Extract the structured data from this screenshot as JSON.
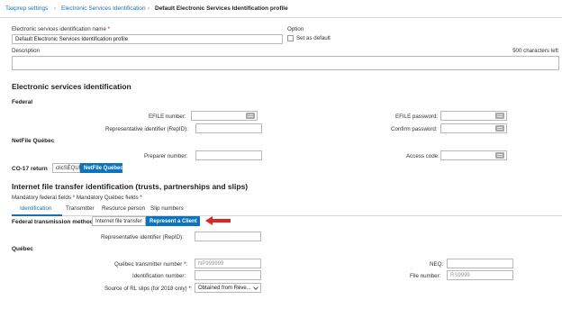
{
  "breadcrumb": {
    "items": [
      "Taxprep settings",
      "Electronic Services Identification",
      "Default Electronic Services Identification profile"
    ]
  },
  "profile": {
    "name_label": "Electronic services identification name",
    "name_value": "Default Electronic Services Identification profile",
    "option_label": "Option",
    "set_default_label": "Set as default",
    "description_label": "Description",
    "chars_left": "500 characters left"
  },
  "esi": {
    "title": "Electronic services identification",
    "federal_title": "Federal",
    "efile_number_label": "EFILE number:",
    "efile_password_label": "EFILE password:",
    "rep_id_label": "Representative identifier (RepID):",
    "confirm_password_label": "Confirm password:",
    "netfile_title": "NetFile Québec",
    "preparer_number_label": "Preparer number:",
    "access_code_label": "Access code:",
    "co17_label": "CO-17 return",
    "co17_options": [
      "clicSÉQUR",
      "NetFile Québec"
    ],
    "co17_selected": "NetFile Québec"
  },
  "ift": {
    "title": "Internet file transfer identification (trusts, partnerships and slips)",
    "mandatory_note": "Mandatory federal fields * Mandatory Québec fields *",
    "tabs": [
      "Identification",
      "Transmitter",
      "Resource person",
      "Slip numbers"
    ],
    "active_tab": "Identification",
    "fed_method_label": "Federal transmission method",
    "methods": [
      "Internet file transfer",
      "Represent a Client"
    ],
    "selected_method": "Represent a Client",
    "rep_id_label": "Representative identifier (RepID):",
    "quebec_title": "Québec",
    "qc_transmitter_label": "Québec transmitter number *:",
    "qc_transmitter_placeholder": "NP999999",
    "neq_label": "NEQ:",
    "identification_number_label": "Identification number:",
    "file_number_label": "File number:",
    "file_number_placeholder": "RS9999",
    "rl_source_label": "Source of RL slips (for 2018 only) *:",
    "rl_source_value": "Obtained from Reve..."
  },
  "colors": {
    "accent": "#0b74bd",
    "link": "#1a6fb5",
    "required": "#cc0000",
    "annotation_arrow": "#e02424"
  }
}
